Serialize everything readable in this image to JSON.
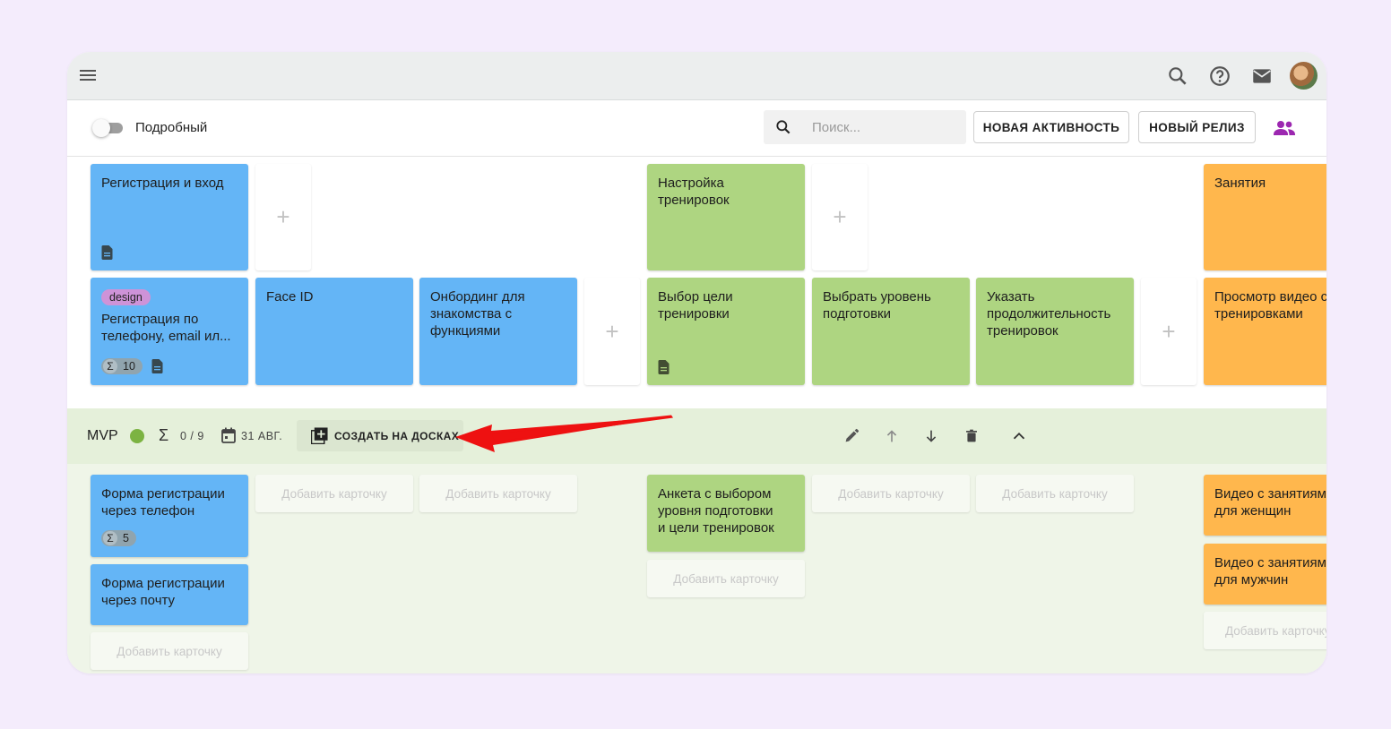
{
  "toolbar": {
    "toggle_label": "Подробный",
    "search_placeholder": "Поиск...",
    "new_activity": "НОВАЯ АКТИВНОСТЬ",
    "new_release": "НОВЫЙ РЕЛИЗ"
  },
  "activities": [
    {
      "title": "Регистрация и вход",
      "color": "#64b5f6"
    },
    {
      "title": "Настройка\nтренировок",
      "color": "#aed581"
    },
    {
      "title": "Занятия",
      "color": "#ffb74d"
    }
  ],
  "steps": {
    "registration_phone": {
      "tag": "design",
      "title": "Регистрация по\nтелефону, email ил...",
      "estimate": "10"
    },
    "face_id": "Face ID",
    "onboarding": "Онбординг для\nзнакомства с\nфункциями",
    "goal": "Выбор цели\nтренировки",
    "level": "Выбрать уровень\nподготовки",
    "duration": "Указать\nпродолжительность\nтренировок",
    "watch_video": "Просмотр видео с\nтренировками"
  },
  "release": {
    "name": "MVP",
    "progress": "0 / 9",
    "date": "31 АВГ.",
    "create_label": "СОЗДАТЬ НА ДОСКАХ",
    "status_color": "#7cb342"
  },
  "release_cards": {
    "phone_form": {
      "title": "Форма регистрации\nчерез телефон",
      "estimate": "5"
    },
    "email_form": "Форма регистрации\nчерез почту",
    "questionnaire": "Анкета с выбором\nуровня подготовки\nи цели тренировок",
    "video_women": "Видео с занятиями\nдля женщин",
    "video_men": "Видео с занятиями\nдля мужчин"
  },
  "add_card_label": "Добавить карточку",
  "add_card_label_cut": "Добавить карточку",
  "colors": {
    "annotation_arrow": "#ee1111",
    "accent": "#9c27b0"
  }
}
